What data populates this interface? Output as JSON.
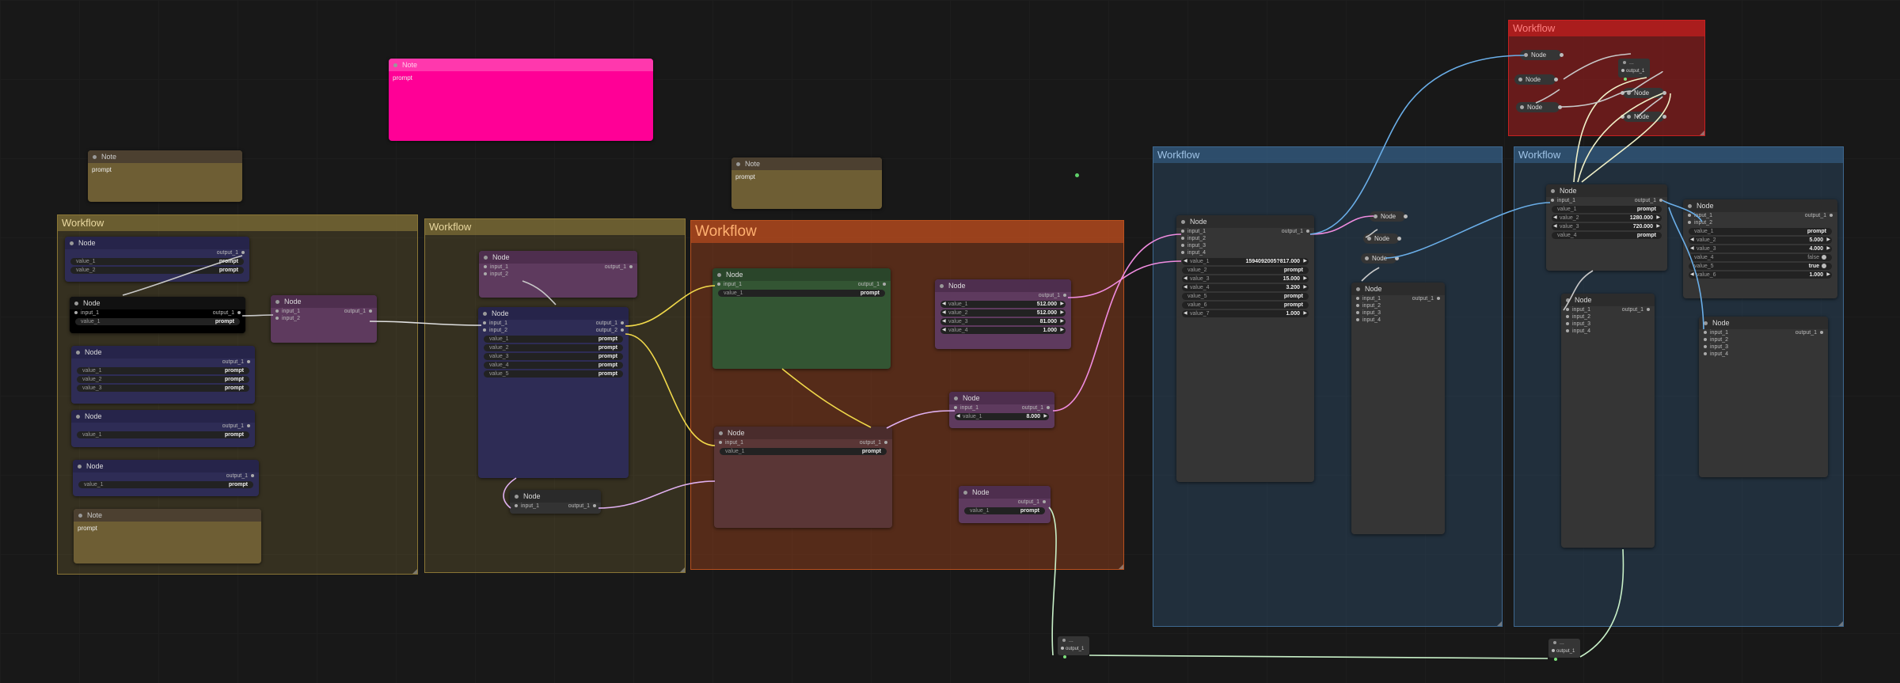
{
  "groups": {
    "g1": {
      "title": "Workflow",
      "color": "#a08a40"
    },
    "g2": {
      "title": "Workflow",
      "color": "#a08a40"
    },
    "g3": {
      "title": "Workflow",
      "color": "#c8501e"
    },
    "g4": {
      "title": "Workflow",
      "color": "#3a6b9a"
    },
    "g5": {
      "title": "Workflow",
      "color": "#3a6b9a"
    },
    "g6": {
      "title": "Workflow",
      "color": "#c81e1e"
    }
  },
  "nodes": {
    "note_pink": {
      "title": "Note",
      "body": "prompt"
    },
    "note_top": {
      "title": "Note",
      "body": "prompt"
    },
    "note_mid": {
      "title": "Note",
      "body": "prompt"
    },
    "note_g1": {
      "title": "Note",
      "body": "prompt"
    },
    "a1": {
      "title": "Node",
      "out": "output_1",
      "w1": "value_1",
      "v1": "prompt",
      "w2": "value_2",
      "v2": "prompt"
    },
    "a2": {
      "title": "Node",
      "in": "input_1",
      "out": "output_1",
      "w1": "value_1",
      "v1": "prompt"
    },
    "a3": {
      "title": "Node",
      "out": "output_1",
      "w1": "value_1",
      "v1": "prompt",
      "w2": "value_2",
      "v2": "prompt",
      "w3": "value_3",
      "v3": "prompt"
    },
    "a4": {
      "title": "Node",
      "out": "output_1",
      "w1": "value_1",
      "v1": "prompt"
    },
    "a5": {
      "title": "Node",
      "out": "output_1",
      "w1": "value_1",
      "v1": "prompt"
    },
    "a6": {
      "title": "Node",
      "in1": "input_1",
      "in2": "input_2",
      "out": "output_1"
    },
    "b1": {
      "title": "Node",
      "in1": "input_1",
      "in2": "input_2",
      "out": "output_1"
    },
    "b2": {
      "title": "Node",
      "in1": "input_1",
      "in2": "input_2",
      "out1": "output_1",
      "out2": "output_2",
      "w1": "value_1",
      "w2": "value_2",
      "w3": "value_3",
      "w4": "value_4",
      "w5": "value_5",
      "v": "prompt"
    },
    "b3": {
      "title": "Node",
      "in": "input_1",
      "out": "output_1"
    },
    "c1": {
      "title": "Node",
      "in": "input_1",
      "out": "output_1",
      "w1": "value_1",
      "v1": "prompt"
    },
    "c2": {
      "title": "Node",
      "in": "input_1",
      "out": "output_1",
      "w1": "value_1",
      "v1": "prompt"
    },
    "c3": {
      "title": "Node",
      "out": "output_1",
      "w1": "value_1",
      "v1": "512.000",
      "w2": "value_2",
      "v2": "512.000",
      "w3": "value_3",
      "v3": "81.000",
      "w4": "value_4",
      "v4": "1.000"
    },
    "c4": {
      "title": "Node",
      "in": "input_1",
      "out": "output_1",
      "w1": "value_1",
      "v1": "8.000"
    },
    "c5": {
      "title": "Node",
      "out": "output_1",
      "w1": "value_1",
      "v1": "prompt"
    },
    "d1": {
      "title": "Node",
      "in1": "input_1",
      "in2": "input_2",
      "in3": "input_3",
      "in4": "input_4",
      "out": "output_1",
      "w1": "value_1",
      "v1": "1594092005?817.000",
      "w2": "value_2",
      "v2": "prompt",
      "w3": "value_3",
      "v3": "15.000",
      "w4": "value_4",
      "v4": "3.200",
      "w5": "value_5",
      "v5": "prompt",
      "w6": "value_6",
      "v6": "prompt",
      "w7": "value_7",
      "v7": "1.000"
    },
    "d2": {
      "title": "Node",
      "in1": "input_1",
      "in2": "input_2",
      "in3": "input_3",
      "in4": "input_4",
      "out": "output_1"
    },
    "e1": {
      "title": "Node",
      "in": "input_1",
      "out": "output_1",
      "w1": "value_1",
      "v1": "prompt",
      "w2": "value_2",
      "v2": "1280.000",
      "w3": "value_3",
      "v3": "720.000",
      "w4": "value_4",
      "v4": "prompt"
    },
    "e2": {
      "title": "Node",
      "in1": "input_1",
      "in2": "input_2",
      "in3": "input_3",
      "in4": "input_4",
      "out": "output_1"
    },
    "e3": {
      "title": "Node",
      "in1": "input_1",
      "in2": "input_2",
      "out": "output_1",
      "w1": "value_1",
      "v1": "prompt",
      "w2": "value_2",
      "v2": "5.000",
      "w3": "value_3",
      "v3": "4.000",
      "w4": "value_4",
      "v4": "false",
      "w5": "value_5",
      "v5": "true",
      "w6": "value_6",
      "v6": "1.000"
    },
    "e4": {
      "title": "Node",
      "in1": "input_1",
      "in2": "input_2",
      "in3": "input_3",
      "in4": "input_4",
      "out": "output_1"
    }
  },
  "minis": {
    "label": "Node"
  },
  "reroutes": {
    "r1": {
      "title": "...",
      "out": "output_1"
    },
    "r2": {
      "title": "...",
      "out": "output_1"
    },
    "r3": {
      "title": "...",
      "out": "output_1"
    }
  }
}
